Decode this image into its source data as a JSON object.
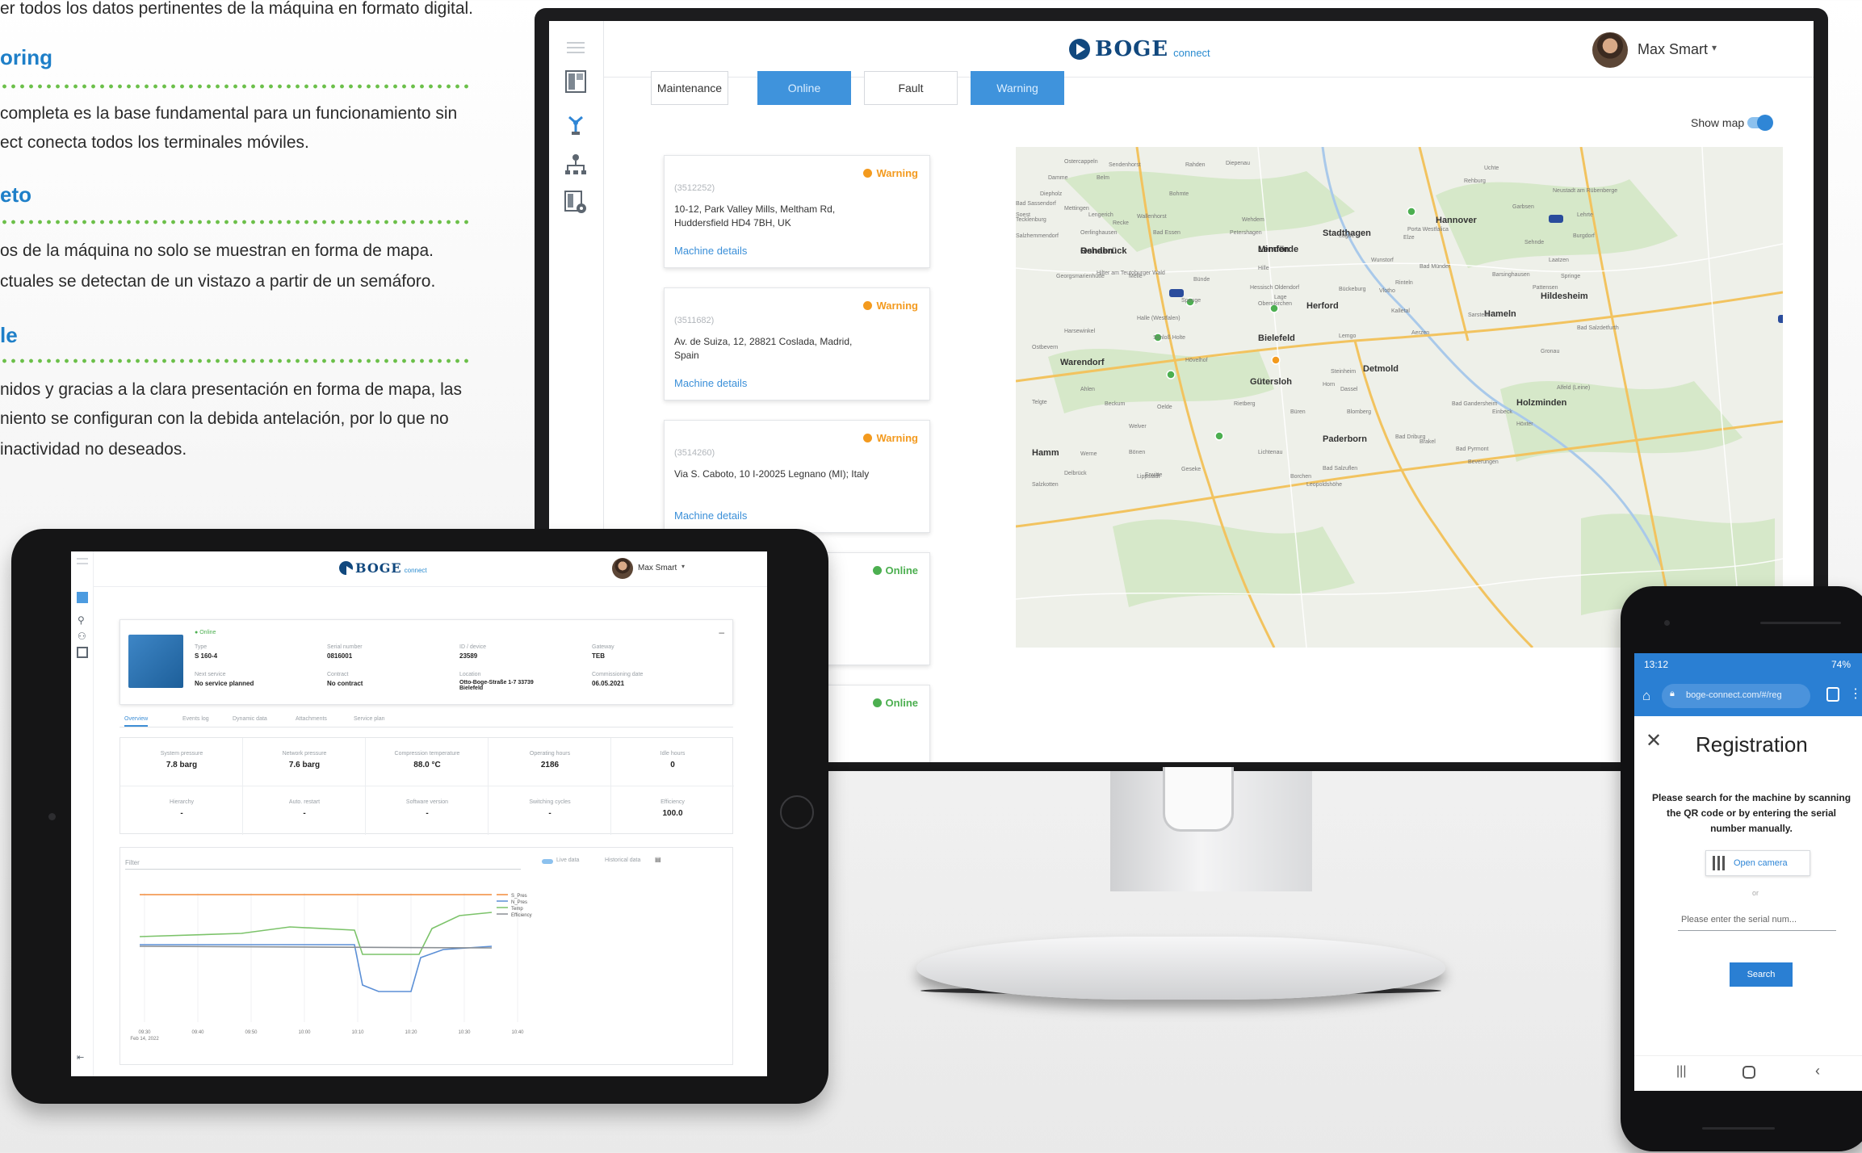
{
  "marketing": {
    "line1": "er todos los datos pertinentes de la máquina en formato digital.",
    "heading1": "oring",
    "line2": "completa es la base fundamental para un funcionamiento sin",
    "line3": "ect conecta todos los terminales móviles.",
    "heading2": "eto",
    "line4": "os de la máquina no solo se muestran en forma de mapa.",
    "line5": "ctuales se detectan de un vistazo a partir de un semáforo.",
    "heading3": "le",
    "line6": "nidos y gracias a la clara presentación en forma de mapa, las",
    "line7": "niento se configuran con la debida antelación, por lo que no",
    "line8": "inactividad no deseados."
  },
  "desktop": {
    "brand": "BOGE",
    "brand_sub": "connect",
    "user_name": "Max Smart",
    "filters": [
      "Maintenance",
      "Online",
      "Fault",
      "Warning"
    ],
    "show_map_label": "Show map",
    "cards": [
      {
        "status": "Warning",
        "serial": "(3512252)",
        "address": "10-12, Park Valley Mills, Meltham Rd, Huddersfield HD4 7BH, UK",
        "link": "Machine details"
      },
      {
        "status": "Warning",
        "serial": "(3511682)",
        "address": "Av. de Suiza, 12, 28821 Coslada, Madrid, Spain",
        "link": "Machine details"
      },
      {
        "status": "Warning",
        "serial": "(3514260)",
        "address": "Via S. Caboto, 10 I-20025  Legnano (MI); Italy",
        "link": "Machine details"
      },
      {
        "status": "Online",
        "serial": "",
        "address": "",
        "link": ""
      },
      {
        "status": "Online",
        "serial": "",
        "address": "",
        "link": ""
      }
    ],
    "map_labels": [
      "Osnabrück",
      "Minden",
      "Stadthagen",
      "Hannover",
      "Herford",
      "Bielefeld",
      "Hameln",
      "Hildesheim",
      "Warendorf",
      "Gütersloh",
      "Detmold",
      "Holzminden",
      "Paderborn",
      "Höxter",
      "Hamm",
      "Lippstadt",
      "Georgsmarienhütte",
      "Melle",
      "Bünde",
      "Vlotho",
      "Rinteln",
      "Lemgo",
      "Kalletal",
      "Bad Pyrmont",
      "Spenge",
      "Rehburg",
      "Garbsen",
      "Lehrte",
      "Bad Salzdetfurth",
      "Bad Driburg",
      "Brakel",
      "Beverungen",
      "Geseke",
      "Erwitte",
      "Werne",
      "Ahlen",
      "Beckum",
      "Oelde",
      "Rietberg",
      "Hövelhof",
      "Schloß Holte",
      "Oerlinghausen",
      "Bad Essen",
      "Bohmte",
      "Wehdem",
      "Petershagen",
      "Hille",
      "Porta Westfalica",
      "Barsinghausen",
      "Springe",
      "Gronau",
      "Alfeld (Leine)",
      "Bad Gandersheim",
      "Einbeck",
      "Dassel",
      "Steinheim",
      "Horn",
      "Blomberg",
      "Lügde",
      "Aerzen",
      "Salzhemmendorf",
      "Tecklenburg",
      "Lengerich",
      "Hilter am Teutoburger Wald",
      "Halle (Westfalen)",
      "Harsewinkel",
      "Ostbevern",
      "Telgte",
      "Sendenhorst",
      "Rahden",
      "Diepenau",
      "Uchte",
      "Neustadt am Rübenberge",
      "Burgdorf",
      "Sehnde",
      "Laatzen",
      "Pattensen",
      "Sarstedt",
      "Elze",
      "Bad Münder",
      "Wunstorf",
      "Bückeburg",
      "Obernkirchen",
      "Hessisch Oldendorf",
      "Lage",
      "Bad Salzuflen",
      "Leopoldshöhe",
      "Borchen",
      "Lichtenau",
      "Büren",
      "Salzkotten",
      "Delbrück",
      "Bönen",
      "Welver",
      "Soest",
      "Bad Sassendorf",
      "Mettingen",
      "Recke",
      "Wallenhorst",
      "Belm",
      "Ostercappeln",
      "Damme",
      "Diepholz",
      "Rehden",
      "Lemförde"
    ],
    "map_label_positions": []
  },
  "tablet": {
    "brand": "BOGE",
    "brand_sub": "connect",
    "user_name": "Max Smart",
    "status_text": "Online",
    "fields": [
      {
        "label": "Type",
        "value": "S 160-4"
      },
      {
        "label": "Serial number",
        "value": "0816001"
      },
      {
        "label": "ID / device",
        "value": "23589"
      },
      {
        "label": "Gateway",
        "value": "TEB"
      },
      {
        "label": "Next service",
        "value": "No service planned"
      },
      {
        "label": "Contract",
        "value": "No contract"
      },
      {
        "label": "Location",
        "value": "Otto-Boge-Straße 1-7 33739 Bielefeld"
      },
      {
        "label": "Commissioning date",
        "value": "06.05.2021"
      }
    ],
    "tabs": [
      "Overview",
      "Events log",
      "Dynamic data",
      "Attachments",
      "Service plan"
    ],
    "metrics": [
      {
        "label": "System pressure",
        "value": "7.8 barg"
      },
      {
        "label": "Network pressure",
        "value": "7.6 barg"
      },
      {
        "label": "Compression temperature",
        "value": "88.0 °C"
      },
      {
        "label": "Operating hours",
        "value": "2186"
      },
      {
        "label": "Idle hours",
        "value": "0"
      },
      {
        "label": "Hierarchy",
        "value": "-"
      },
      {
        "label": "Auto. restart",
        "value": "-"
      },
      {
        "label": "Software version",
        "value": "-"
      },
      {
        "label": "Switching cycles",
        "value": "-"
      },
      {
        "label": "Efficiency",
        "value": "100.0"
      }
    ],
    "chart_filter_label": "Filter",
    "live_data_label": "Live data",
    "historical_label": "Historical data",
    "legend": [
      "S_Pres",
      "N_Pres",
      "Temp",
      "Efficiency"
    ],
    "x_ticks": [
      "09:30",
      "09:40",
      "09:50",
      "10:00",
      "10:10",
      "10:20",
      "10:30",
      "10:40"
    ],
    "x_date": "Feb 14, 2022"
  },
  "phone": {
    "time": "13:12",
    "status_icons": "74%",
    "url": "boge-connect.com/#/reg",
    "title": "Registration",
    "instruction": "Please search for the machine by scanning the QR code or by entering the serial number manually.",
    "open_camera": "Open camera",
    "or_text": "or",
    "serial_placeholder": "Please enter the serial num...",
    "search_button": "Search"
  },
  "colors": {
    "accent": "#3f93dc",
    "warning": "#f39a1e",
    "online": "#4caf50",
    "brand": "#11487e",
    "green_dots": "#6cc04a"
  }
}
